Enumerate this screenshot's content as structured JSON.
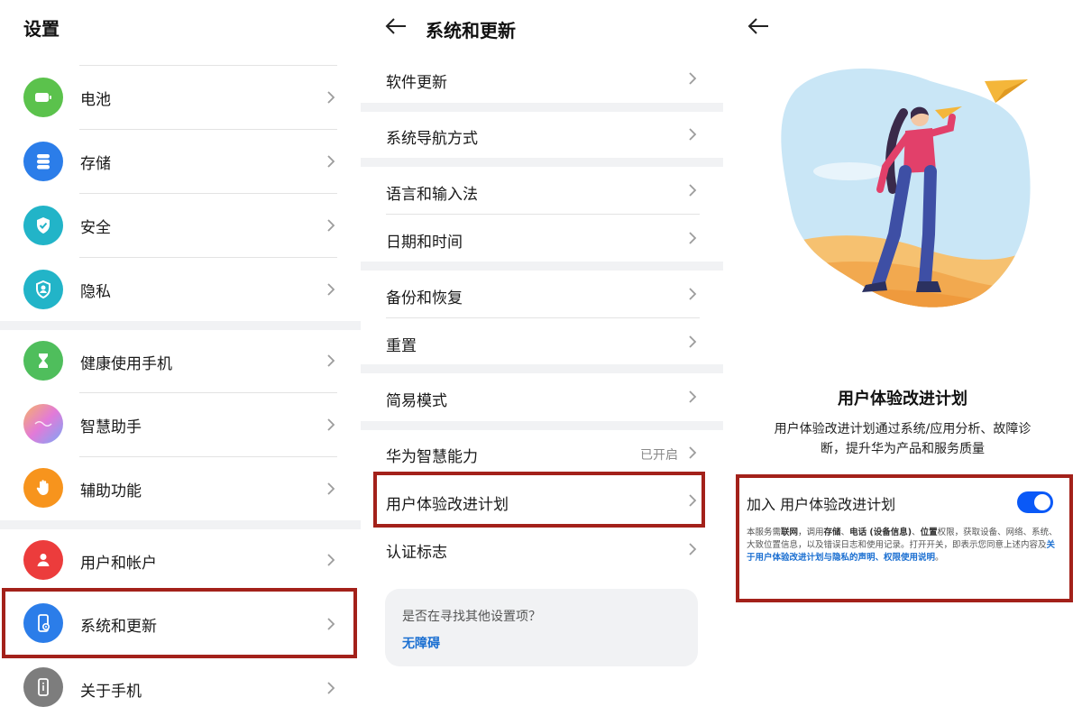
{
  "panel1": {
    "title": "设置",
    "items": [
      {
        "label": "电池",
        "icon": "battery-icon",
        "color": "#5bc24c"
      },
      {
        "label": "存储",
        "icon": "storage-icon",
        "color": "#2b7de9"
      },
      {
        "label": "安全",
        "icon": "shield-check-icon",
        "color": "#22b4c8"
      },
      {
        "label": "隐私",
        "icon": "privacy-icon",
        "color": "#22b4c8"
      },
      {
        "label": "健康使用手机",
        "icon": "hourglass-icon",
        "color": "#4fbe5c"
      },
      {
        "label": "智慧助手",
        "icon": "assistant-icon",
        "color": "#c58be0"
      },
      {
        "label": "辅助功能",
        "icon": "hand-icon",
        "color": "#f7941d"
      },
      {
        "label": "用户和帐户",
        "icon": "user-icon",
        "color": "#ec3c3c"
      },
      {
        "label": "系统和更新",
        "icon": "phone-settings-icon",
        "color": "#2b7de9"
      },
      {
        "label": "关于手机",
        "icon": "phone-info-icon",
        "color": "#7d7d7d"
      }
    ]
  },
  "panel2": {
    "title": "系统和更新",
    "items": [
      {
        "label": "软件更新"
      },
      {
        "label": "系统导航方式"
      },
      {
        "label": "语言和输入法"
      },
      {
        "label": "日期和时间"
      },
      {
        "label": "备份和恢复"
      },
      {
        "label": "重置"
      },
      {
        "label": "简易模式"
      },
      {
        "label": "华为智慧能力",
        "value": "已开启"
      },
      {
        "label": "用户体验改进计划"
      },
      {
        "label": "认证标志"
      }
    ],
    "search_card": {
      "question": "是否在寻找其他设置项？",
      "link": "无障碍"
    }
  },
  "panel3": {
    "heading": "用户体验改进计划",
    "description_line1": "用户体验改进计划通过系统/应用分析、故障诊",
    "description_line2": "断，提升华为产品和服务质量",
    "toggle_label": "加入 用户体验改进计划",
    "toggle_on": true,
    "fine_print": {
      "p1": "本服务需",
      "b1": "联网",
      "p2": "，调用",
      "b2": "存储",
      "p3": "、",
      "b3": "电话 (设备信息)",
      "p4": "、",
      "b4": "位置",
      "p5": "权限，获取设备、网络、系统、大致位置信息，以及错误日志和使用记录。打开开关，即表示您同意上述内容及",
      "link": "关于用户体验改进计划与隐私的声明、权限使用说明",
      "end": "。"
    }
  },
  "colors": {
    "accent": "#0a59f7",
    "highlight_border": "#a3211a",
    "link": "#1b6fd1"
  }
}
